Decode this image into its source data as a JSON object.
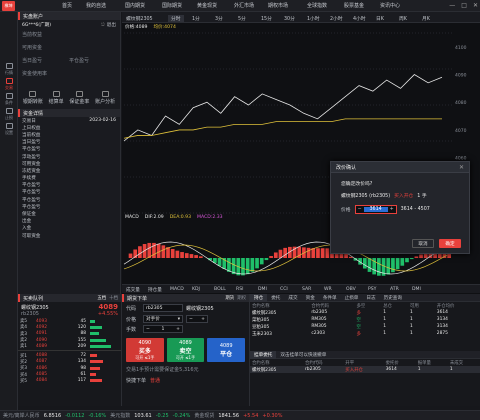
{
  "app": {
    "logo": "橡坤"
  },
  "nav": [
    "首页",
    "我的自选",
    "国内期货",
    "国际期货",
    "黄金现货",
    "外汇市场",
    "期权市场",
    "全球指数",
    "股票基金",
    "资讯中心"
  ],
  "rail": [
    {
      "label": "行情",
      "on": false
    },
    {
      "label": "交易",
      "on": true
    },
    {
      "label": "条件",
      "on": false
    },
    {
      "label": "止损",
      "on": false
    },
    {
      "label": "设置",
      "on": false
    }
  ],
  "account": {
    "header": "实盘账户",
    "user": "6G***6(广期)",
    "logout": "退出",
    "summary": [
      [
        "当前权益",
        ""
      ],
      [
        "可用资金",
        ""
      ],
      [
        "当日盈亏",
        ""
      ],
      [
        "平仓盈亏",
        ""
      ],
      [
        "资金使用率",
        ""
      ]
    ],
    "actions": [
      "银期转账",
      "结算单",
      "保证金率",
      "账户分析"
    ],
    "detail_header": "资金详情",
    "date_label": "交易日",
    "date": "2023-02-16",
    "rows": [
      "上日权益",
      "当前权益",
      "当日盈亏",
      "平仓盈亏",
      "浮动盈亏",
      "可用资金",
      "冻结资金",
      "手续费",
      "平仓盈亏",
      "平仓盈亏",
      "平仓盈亏",
      "平仓盈亏",
      "保证金",
      "出金",
      "入金",
      "可取资金"
    ]
  },
  "chart": {
    "symbol": "螺纹钢2305",
    "timeframe": "分时",
    "tfs": [
      "1分",
      "3分",
      "5分",
      "15分",
      "30分",
      "1小时",
      "2小时",
      "4小时",
      "日K",
      "周K",
      "月K"
    ],
    "price_label": "价格:4089",
    "avg_label": "均价:4074",
    "yticks": [
      "4100",
      "4090",
      "4080",
      "4070",
      "4060",
      "4050"
    ],
    "macd_label": "MACD",
    "dif": "DIF:2.09",
    "dea": "DEA:0.93",
    "macd": "MACD:2.33",
    "indicators": [
      "成交量",
      "持仓量",
      "MACD",
      "KDJ",
      "BOLL",
      "RSI",
      "DMI",
      "CCI",
      "SAR",
      "WR",
      "OBV",
      "PSY",
      "ATR",
      "DMI"
    ]
  },
  "chart_data": {
    "type": "line",
    "series": [
      {
        "name": "价格",
        "values": [
          4066,
          4070,
          4068,
          4075,
          4072,
          4078,
          4080,
          4076,
          4082,
          4079,
          4083,
          4081,
          4079,
          4076,
          4074,
          4078,
          4082,
          4086,
          4084,
          4088,
          4085,
          4090,
          4087,
          4089
        ]
      },
      {
        "name": "均价",
        "values": [
          4067,
          4068,
          4068,
          4069,
          4070,
          4070,
          4071,
          4071,
          4072,
          4072,
          4072,
          4073,
          4073,
          4073,
          4073,
          4073,
          4074,
          4074,
          4074,
          4074,
          4074,
          4074,
          4074,
          4074
        ]
      }
    ],
    "ylim": [
      4040,
      4105
    ]
  },
  "dialog": {
    "title": "改价确认",
    "question": "您确定改价吗?",
    "info1": "螺纹钢2305 (rb2305)",
    "side": "买入开仓",
    "qty": "1 手",
    "price_label": "价格",
    "price": "3614",
    "range": "3614 - 4507",
    "cancel": "取消",
    "confirm": "确定"
  },
  "quote": {
    "header": "买卖队列",
    "tabs": [
      "五档",
      "十档"
    ],
    "name": "螺纹钢2305",
    "code": "rb2305",
    "price": "4089",
    "change": "+4.55%",
    "asks": [
      [
        "卖5",
        "4093",
        "45"
      ],
      [
        "卖4",
        "4092",
        "120"
      ],
      [
        "卖3",
        "4091",
        "88"
      ],
      [
        "卖2",
        "4090",
        "155"
      ],
      [
        "卖1",
        "4089",
        "209"
      ]
    ],
    "bids": [
      [
        "买1",
        "4088",
        "72"
      ],
      [
        "买2",
        "4087",
        "134"
      ],
      [
        "买3",
        "4086",
        "98"
      ],
      [
        "买4",
        "4085",
        "61"
      ],
      [
        "买5",
        "4084",
        "117"
      ]
    ]
  },
  "order": {
    "header": "期货下单",
    "tabs": [
      "期货",
      "期权"
    ],
    "code_label": "代码",
    "code": "rb2305",
    "name": "螺纹钢2305",
    "price_label": "价格",
    "price_mode": "对手价",
    "qty_label": "手数",
    "qty": "1",
    "buy_price": "4090",
    "sell_price": "4089",
    "close_price": "4089",
    "buy": "买多",
    "sell": "卖空",
    "close": "平仓",
    "buy_sub": "可开 ≤1手",
    "sell_sub": "可开 ≤1手",
    "close_sub": "",
    "note": "交易1手预计需要保证金5,316元",
    "mode_label": "快捷下单",
    "mode_val": "普通"
  },
  "positions": {
    "tabs": [
      "持仓",
      "委托",
      "成交",
      "资金",
      "条件单",
      "止损单",
      "日志",
      "历史查询"
    ],
    "cols": [
      "合约名称",
      "合约代码",
      "多空",
      "总仓",
      "可用",
      "开仓均价"
    ],
    "rows": [
      [
        "螺纹钢2305",
        "rb2305",
        "多",
        "1",
        "1",
        "3614"
      ],
      [
        "菜粕305",
        "RM305",
        "空",
        "1",
        "1",
        "3134"
      ],
      [
        "豆粕305",
        "RM305",
        "空",
        "1",
        "1",
        "3134"
      ],
      [
        "玉米2303",
        "c2303",
        "多",
        "1",
        "1",
        "2875"
      ]
    ],
    "order_tabs": [
      "挂单委托",
      "双击挂单可以快速撤单"
    ],
    "order_cols": [
      "合约名称",
      "合约代码",
      "开平",
      "委托价",
      "报单量",
      "未成交"
    ],
    "order_rows": [
      [
        "螺纹钢2305",
        "rb2305",
        "买入开仓",
        "3614",
        "1",
        "1"
      ]
    ]
  },
  "status": {
    "items": [
      "美元/离岸人民币",
      "6.8516",
      "-0.0112",
      "-0.16%",
      "美元指数",
      "103.61",
      "-0.25",
      "-0.24%",
      "黄金现货",
      "1841.56",
      "+5.54",
      "+0.30%"
    ]
  }
}
